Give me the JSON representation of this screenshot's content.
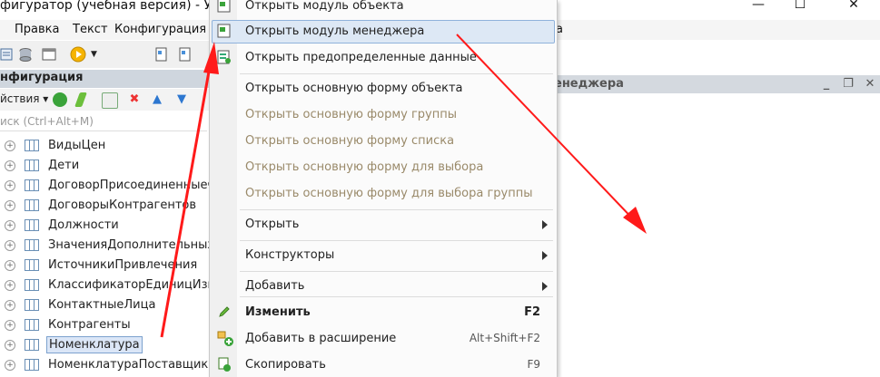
{
  "window": {
    "title": "фигуратор (учебная версия) - Уч",
    "min_glyph": "—",
    "max_glyph": "☐",
    "close_glyph": "✕"
  },
  "menubar": {
    "items": [
      "Правка",
      "Текст",
      "Конфигурация"
    ],
    "tail": "а"
  },
  "config_panel": {
    "title": "нфигурация",
    "actions_label": "йствия ▾",
    "search_placeholder": "иск (Ctrl+Alt+M)",
    "items": [
      "ВидыЦен",
      "Дети",
      "ДоговорПрисоединенныеФ",
      "ДоговорыКонтрагентов",
      "Должности",
      "ЗначенияДополнительныхР",
      "ИсточникиПривлечения",
      "КлассификаторЕдиницИзм",
      "КонтактныеЛица",
      "Контрагенты",
      "Номенклатура",
      "НоменклатураПоставщика"
    ],
    "selected_index": 10
  },
  "right_window": {
    "title": "енеджера",
    "min": "_",
    "restore": "❐",
    "close": "✕"
  },
  "context_menu": {
    "items": [
      {
        "label": "Открыть модуль объекта",
        "icon": "module-icon"
      },
      {
        "label": "Открыть модуль менеджера",
        "icon": "module-icon",
        "highlighted": true
      },
      {
        "label": "Открыть предопределенные данные",
        "icon": "predefined-icon"
      },
      {
        "label": "Открыть основную форму объекта"
      },
      {
        "label": "Открыть основную форму группы",
        "disabled": true
      },
      {
        "label": "Открыть основную форму списка",
        "disabled": true
      },
      {
        "label": "Открыть основную форму для выбора",
        "disabled": true
      },
      {
        "label": "Открыть основную форму для выбора группы",
        "disabled": true
      },
      {
        "label": "Открыть",
        "submenu": true
      },
      {
        "label": "Конструкторы",
        "submenu": true
      },
      {
        "label": "Добавить",
        "submenu": true
      },
      {
        "label": "Изменить",
        "shortcut": "F2",
        "bold": true,
        "icon": "pencil-icon"
      },
      {
        "label": "Добавить в расширение",
        "shortcut": "Alt+Shift+F2",
        "icon": "add-extension-icon"
      },
      {
        "label": "Скопировать",
        "shortcut": "F9",
        "icon": "copy-icon"
      }
    ]
  },
  "annotation_color": "#ff1a1a"
}
